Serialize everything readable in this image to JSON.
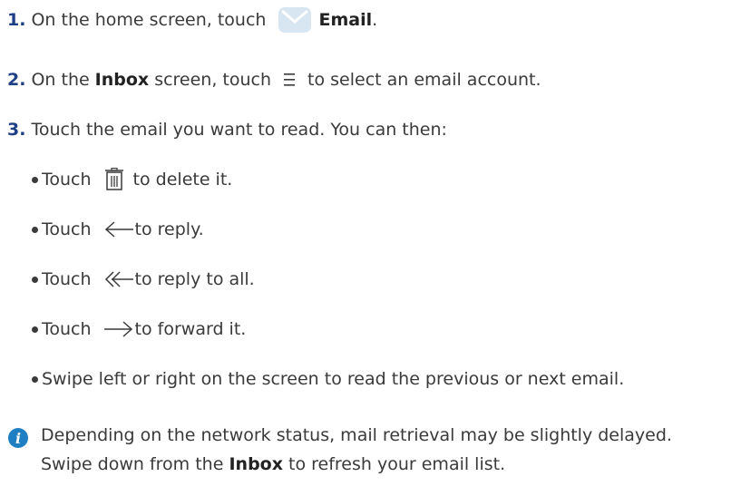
{
  "steps": [
    {
      "num": "1.",
      "pre": "On the home screen, touch",
      "bold": "Email",
      "post": "."
    },
    {
      "num": "2.",
      "pre": "On the",
      "bold": "Inbox",
      "mid": "screen, touch",
      "post": "to select an email account."
    },
    {
      "num": "3.",
      "text": "Touch the email you want to read. You can then:"
    }
  ],
  "bullets": [
    {
      "pre": "Touch",
      "post": "to delete it.",
      "icon": "trash-icon"
    },
    {
      "pre": "Touch",
      "post": "to reply.",
      "icon": "reply-arrow-icon"
    },
    {
      "pre": "Touch",
      "post": "to reply to all.",
      "icon": "reply-all-arrow-icon"
    },
    {
      "pre": "Touch",
      "post": "to forward it.",
      "icon": "forward-arrow-icon"
    },
    {
      "text": "Swipe left or right on the screen to read the previous or next email."
    }
  ],
  "note": {
    "line1": "Depending on the network status, mail retrieval may be slightly delayed.",
    "line2_pre": "Swipe down from the",
    "line2_bold": "Inbox",
    "line2_post": "to refresh your email list.",
    "icon": "info-icon"
  },
  "colors": {
    "accent": "#1f3f86",
    "info": "#1e7fc2",
    "text": "#3a3a3a"
  },
  "icons": {
    "email": "email-app-icon",
    "menu": "menu-icon"
  }
}
